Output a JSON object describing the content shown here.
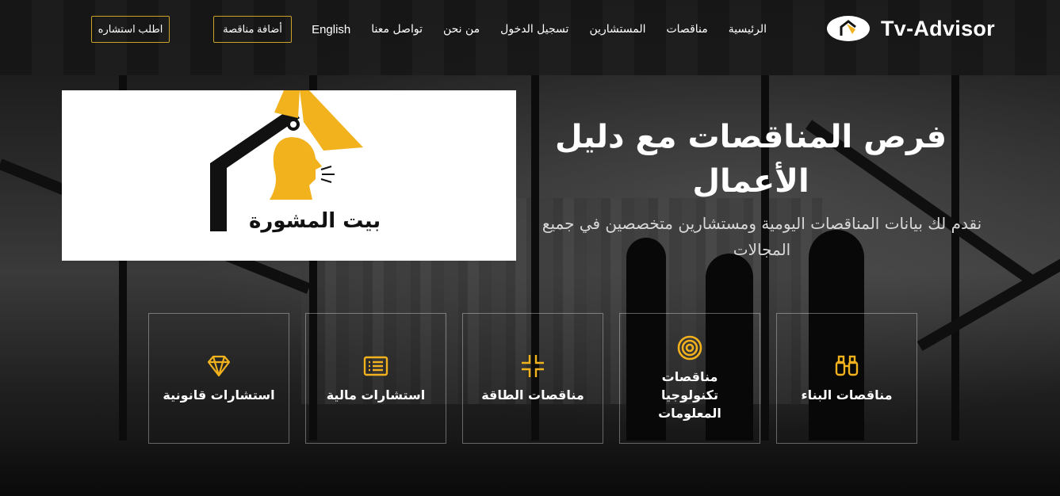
{
  "header": {
    "brand_name": "Tv-Advisor",
    "nav_items": [
      {
        "label": "الرئيسية"
      },
      {
        "label": "مناقصات"
      },
      {
        "label": "المستشارين"
      },
      {
        "label": "تسجيل الدخول"
      },
      {
        "label": "من نحن"
      },
      {
        "label": "تواصل معنا"
      },
      {
        "label": "English"
      }
    ],
    "add_tender_label": "أضافة مناقصة",
    "request_consult_label": "اطلب استشاره"
  },
  "hero": {
    "title": "فرص المناقصات مع دليل الأعمال",
    "subtitle": "نقدم لك بيانات المناقصات اليومية ومستشارين متخصصين في جميع المجالات"
  },
  "promo": {
    "caption": "بيت المشورة"
  },
  "services": [
    {
      "label": "مناقصات البناء",
      "icon": "binoculars-icon"
    },
    {
      "label": "مناقصات تكنولوجيا المعلومات",
      "icon": "target-icon"
    },
    {
      "label": "مناقصات الطاقة",
      "icon": "focus-corners-icon"
    },
    {
      "label": "استشارات مالية",
      "icon": "list-icon"
    },
    {
      "label": "استشارات قانونية",
      "icon": "diamond-icon"
    }
  ],
  "colors": {
    "accent": "#f2b21e",
    "button_border": "#c9a227"
  }
}
